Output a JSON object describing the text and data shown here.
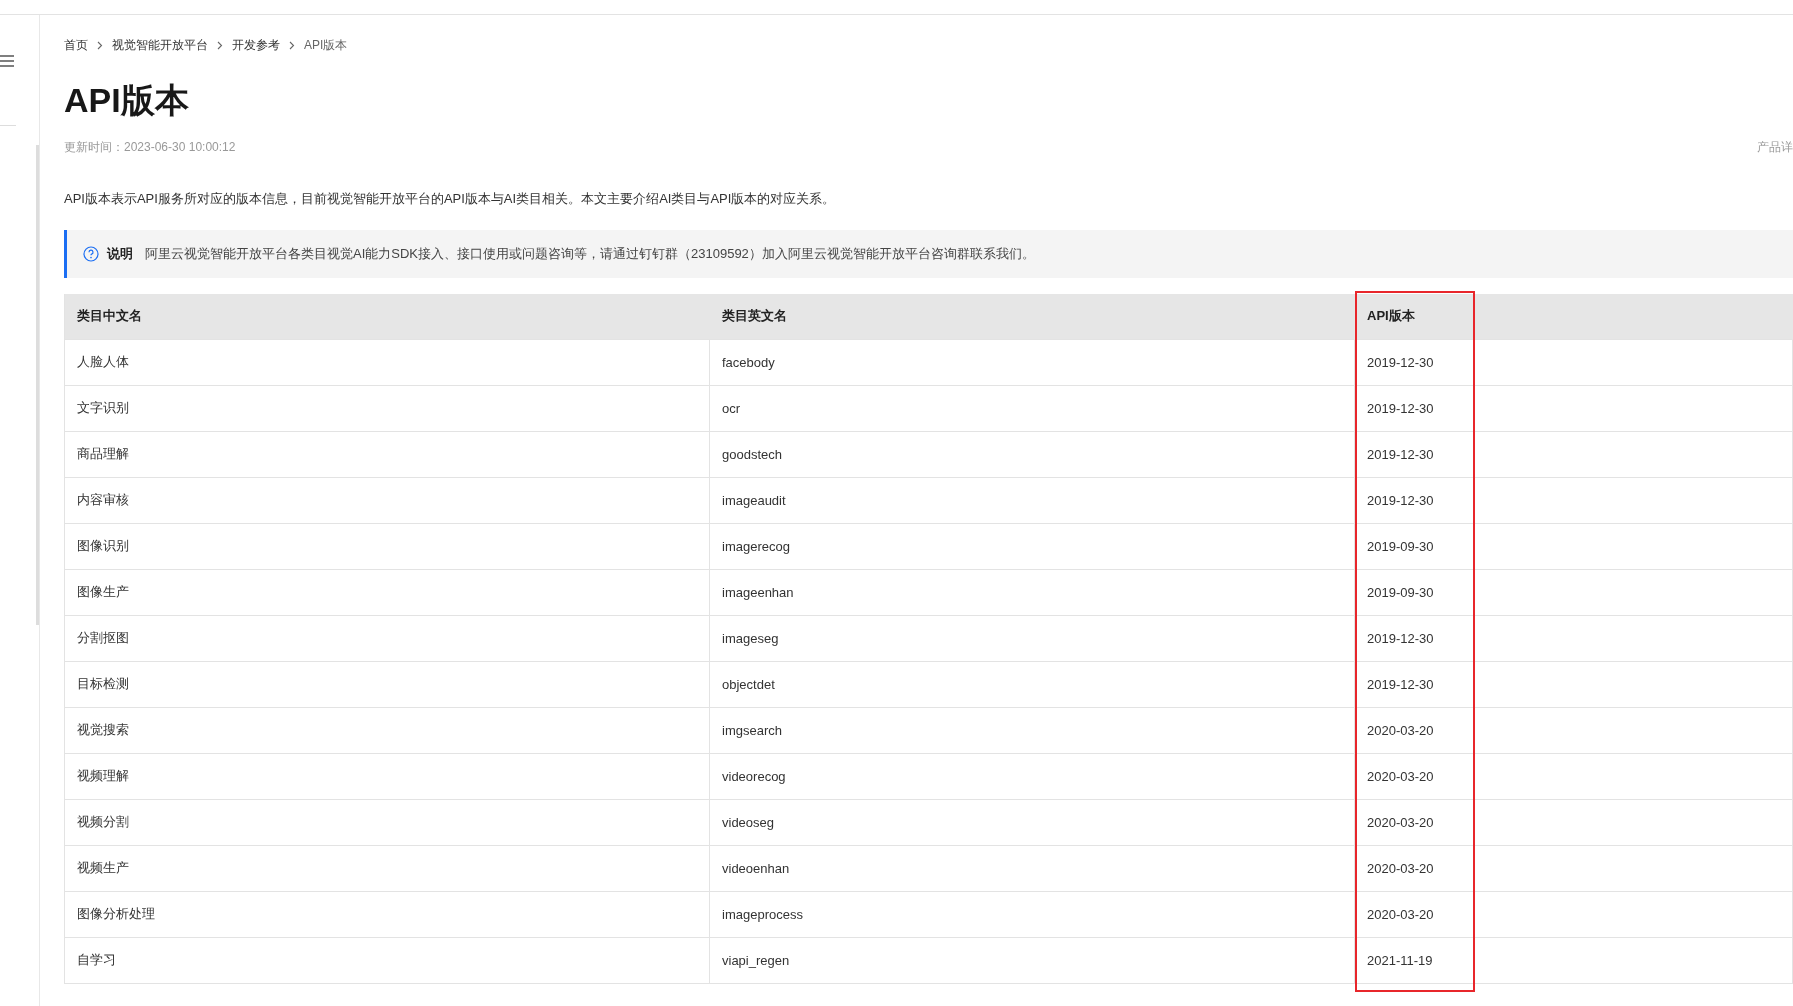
{
  "breadcrumb": [
    "首页",
    "视觉智能开放平台",
    "开发参考",
    "API版本"
  ],
  "title": "API版本",
  "updated": "更新时间：2023-06-30 10:00:12",
  "side_link": "产品详",
  "intro": "API版本表示API服务所对应的版本信息，目前视觉智能开放平台的API版本与AI类目相关。本文主要介绍AI类目与API版本的对应关系。",
  "note": {
    "label": "说明",
    "text": "阿里云视觉智能开放平台各类目视觉AI能力SDK接入、接口使用或问题咨询等，请通过钉钉群（23109592）加入阿里云视觉智能开放平台咨询群联系我们。"
  },
  "table": {
    "columns": [
      {
        "label": "类目中文名",
        "highlighted": false
      },
      {
        "label": "类目英文名",
        "highlighted": false
      },
      {
        "label": "API版本",
        "highlighted": true
      }
    ],
    "rows": [
      [
        "人脸人体",
        "facebody",
        "2019-12-30"
      ],
      [
        "文字识别",
        "ocr",
        "2019-12-30"
      ],
      [
        "商品理解",
        "goodstech",
        "2019-12-30"
      ],
      [
        "内容审核",
        "imageaudit",
        "2019-12-30"
      ],
      [
        "图像识别",
        "imagerecog",
        "2019-09-30"
      ],
      [
        "图像生产",
        "imageenhan",
        "2019-09-30"
      ],
      [
        "分割抠图",
        "imageseg",
        "2019-12-30"
      ],
      [
        "目标检测",
        "objectdet",
        "2019-12-30"
      ],
      [
        "视觉搜索",
        "imgsearch",
        "2020-03-20"
      ],
      [
        "视频理解",
        "videorecog",
        "2020-03-20"
      ],
      [
        "视频分割",
        "videoseg",
        "2020-03-20"
      ],
      [
        "视频生产",
        "videoenhan",
        "2020-03-20"
      ],
      [
        "图像分析处理",
        "imageprocess",
        "2020-03-20"
      ],
      [
        "自学习",
        "viapi_regen",
        "2021-11-19"
      ]
    ]
  }
}
